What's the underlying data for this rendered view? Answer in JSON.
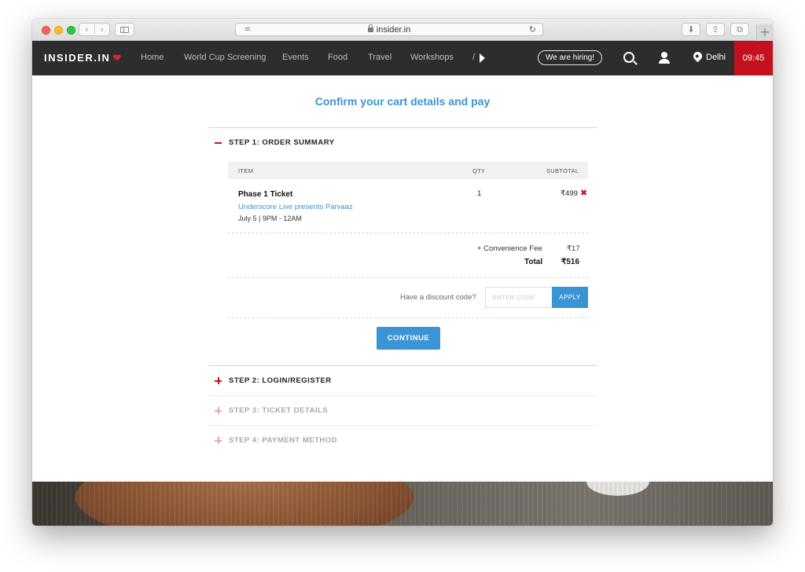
{
  "browser": {
    "url": "insider.in",
    "back_glyph": "‹",
    "forward_glyph": "›",
    "reload_glyph": "↻",
    "new_tab_glyph": "+",
    "reader_glyph": "≡",
    "download_glyph": "⬇",
    "share_glyph": "⇪",
    "tabs_glyph": "⧉"
  },
  "nav": {
    "logo": "INSIDER.IN",
    "logo_mark": "❤",
    "items": [
      "Home",
      "World Cup Screening",
      "Events",
      "Food",
      "Travel",
      "Workshops",
      "/"
    ],
    "hiring": "We are hiring!",
    "city": "Delhi",
    "timer": "09:45",
    "colors": {
      "bar": "#2d2d2d",
      "timer_bg": "#c4111d"
    }
  },
  "page": {
    "title": "Confirm your cart details and pay",
    "accent_color": "#3b94d4"
  },
  "steps": [
    {
      "label": "STEP 1: ORDER SUMMARY",
      "state": "expanded"
    },
    {
      "label": "STEP 2: LOGIN/REGISTER",
      "state": "collapsed"
    },
    {
      "label": "STEP 3: TICKET DETAILS",
      "state": "disabled"
    },
    {
      "label": "STEP 4: PAYMENT METHOD",
      "state": "disabled"
    }
  ],
  "order": {
    "headers": {
      "item": "ITEM",
      "qty": "QTY",
      "subtotal": "SUBTOTAL"
    },
    "line": {
      "name": "Phase 1 Ticket",
      "event": "Underscore Live presents Parvaaz",
      "time": "July 5 | 9PM - 12AM",
      "qty": "1",
      "price": "₹499",
      "remove_glyph": "✖"
    },
    "convenience_label": "+ Convenience Fee",
    "convenience_value": "₹17",
    "total_label": "Total",
    "total_value": "₹516"
  },
  "discount": {
    "prompt": "Have a discount code?",
    "placeholder": "ENTER CODE",
    "apply": "APPLY"
  },
  "continue_label": "CONTINUE"
}
